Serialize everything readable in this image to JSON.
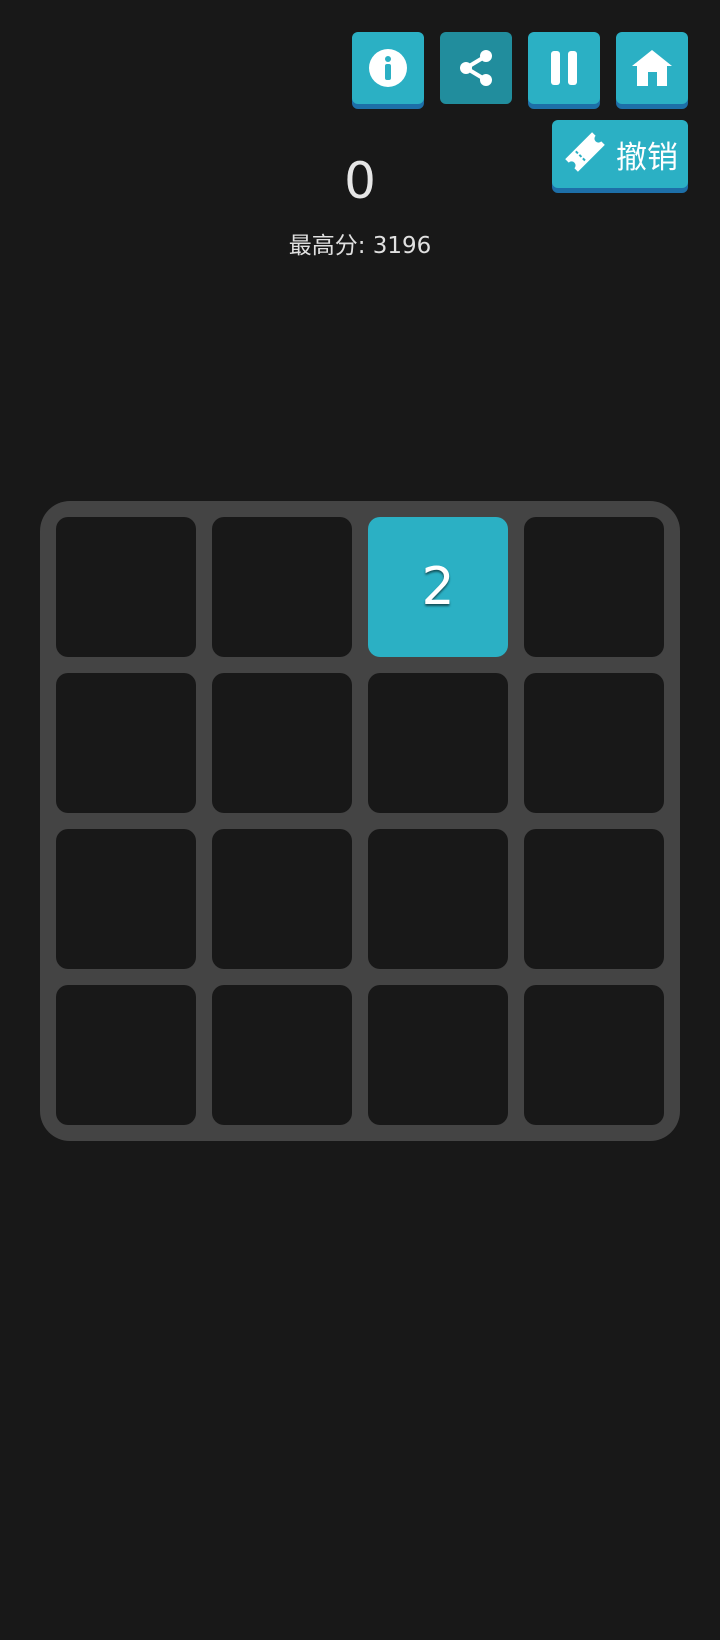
{
  "colors": {
    "background": "#181818",
    "accent": "#2bb0c4",
    "accent_pressed": "#218d9d",
    "button_shadow": "#1d6fa8",
    "board": "#444444",
    "empty_cell": "#181818",
    "text": "#e6e6e6"
  },
  "toolbar": {
    "buttons": [
      {
        "name": "info-button",
        "icon": "info-icon"
      },
      {
        "name": "share-button",
        "icon": "share-icon",
        "active": true
      },
      {
        "name": "pause-button",
        "icon": "pause-icon"
      },
      {
        "name": "home-button",
        "icon": "home-icon"
      }
    ],
    "undo": {
      "icon": "ticket-icon",
      "label": "撤销"
    }
  },
  "score": {
    "current": "0",
    "best_label": "最高分:",
    "best_value": "3196"
  },
  "board": {
    "size": 4,
    "tiles": [
      [
        "",
        "",
        "2",
        ""
      ],
      [
        "",
        "",
        "",
        ""
      ],
      [
        "",
        "",
        "",
        ""
      ],
      [
        "",
        "",
        "",
        ""
      ]
    ]
  }
}
